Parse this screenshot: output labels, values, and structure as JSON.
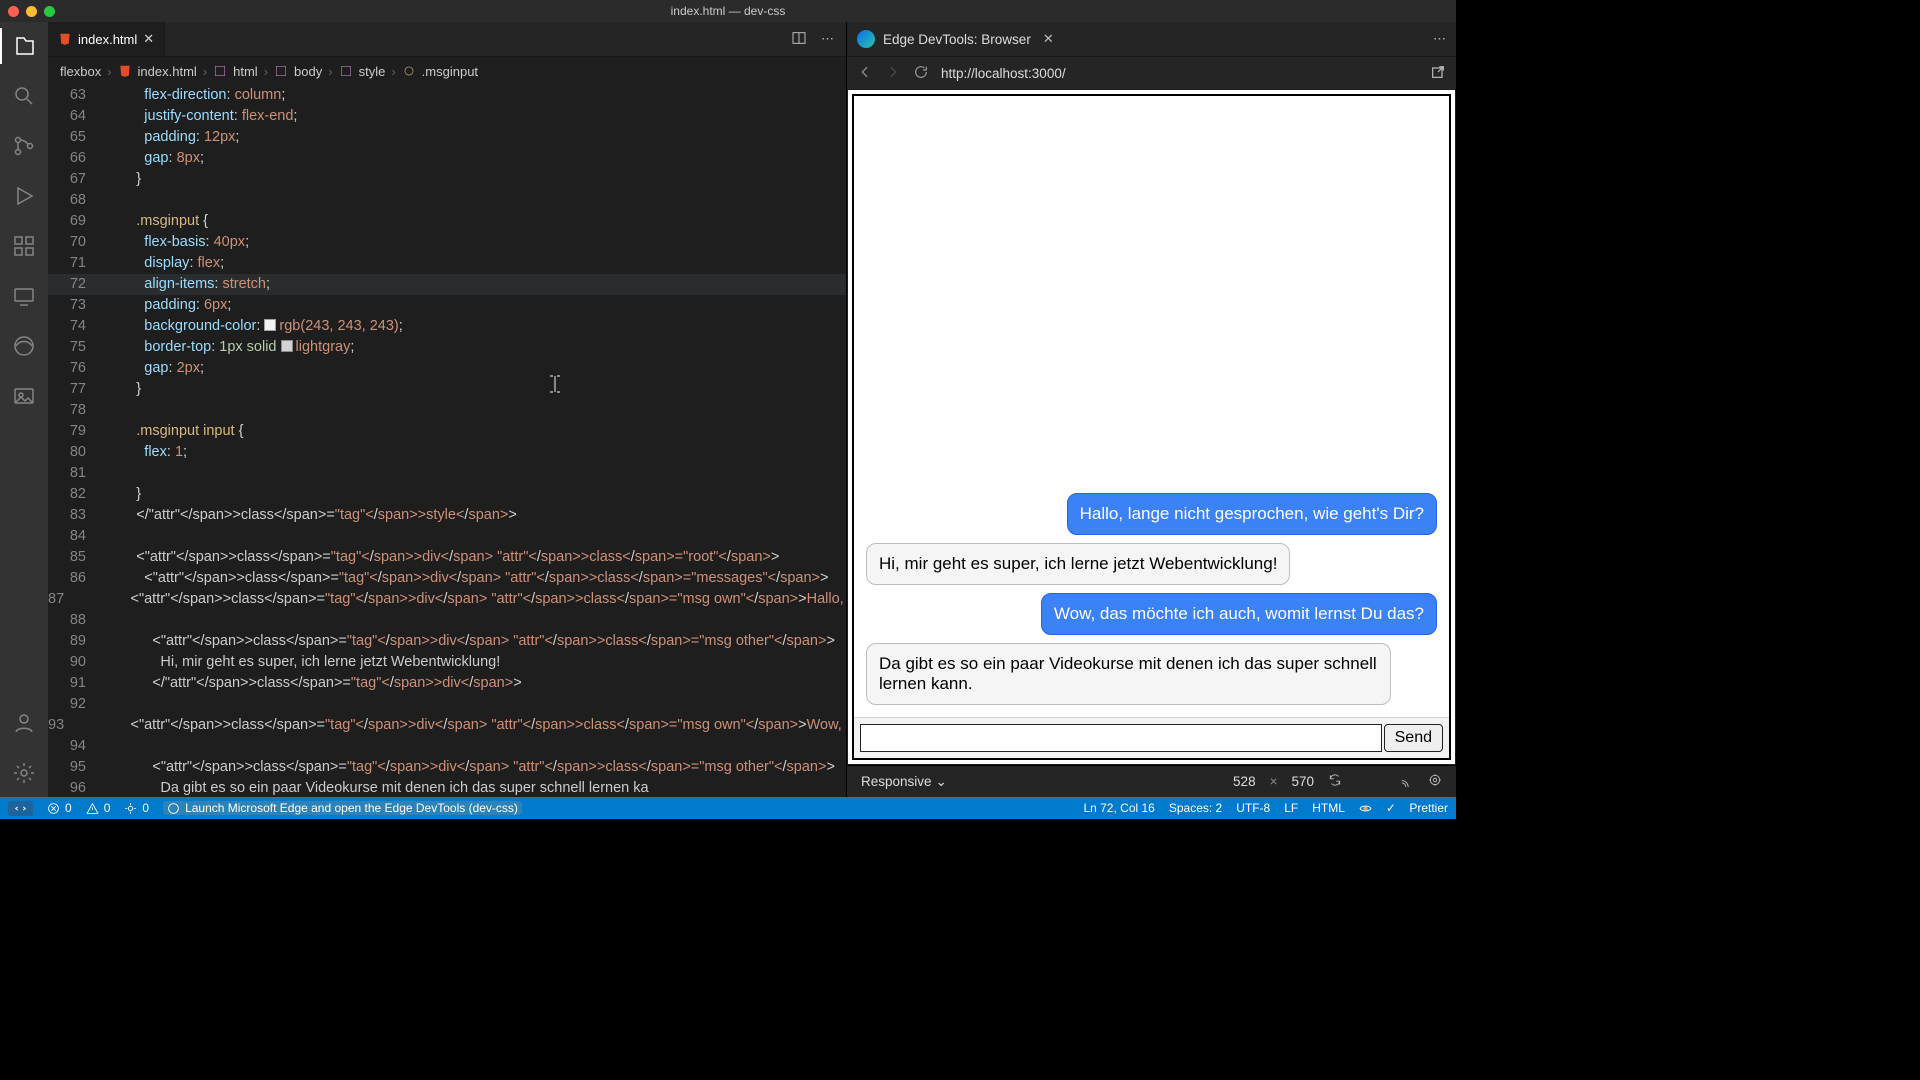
{
  "window_title": "index.html — dev-css",
  "activity_items": [
    "explorer",
    "search",
    "source-control",
    "run-debug",
    "extensions",
    "remote",
    "edge",
    "images"
  ],
  "activity_bottom": [
    "account",
    "settings"
  ],
  "tab": {
    "filename": "index.html"
  },
  "tab_actions": [
    "split-editor",
    "more"
  ],
  "breadcrumbs": [
    "flexbox",
    "index.html",
    "html",
    "body",
    "style",
    ".msginput"
  ],
  "code": [
    {
      "n": 63,
      "prop": "flex-direction",
      "val": "column"
    },
    {
      "n": 64,
      "prop": "justify-content",
      "val": "flex-end"
    },
    {
      "n": 65,
      "prop": "padding",
      "val": "12px"
    },
    {
      "n": 66,
      "prop": "gap",
      "val": "8px"
    },
    {
      "n": 67,
      "close": "}"
    },
    {
      "n": 68,
      "blank": true
    },
    {
      "n": 69,
      "sel": ".msginput",
      "open": "{"
    },
    {
      "n": 70,
      "prop": "flex-basis",
      "val": "40px"
    },
    {
      "n": 71,
      "prop": "display",
      "val": "flex"
    },
    {
      "n": 72,
      "prop": "align-items",
      "val": "stretch",
      "hl": true
    },
    {
      "n": 73,
      "prop": "padding",
      "val": "6px"
    },
    {
      "n": 74,
      "prop": "background-color",
      "sw": "#f3f3f3",
      "val": "rgb(243, 243, 243)"
    },
    {
      "n": 75,
      "prop": "border-top",
      "preval": "1px solid ",
      "sw": "#d3d3d3",
      "val": "lightgray"
    },
    {
      "n": 76,
      "prop": "gap",
      "val": "2px"
    },
    {
      "n": 77,
      "close": "}"
    },
    {
      "n": 78,
      "blank": true
    },
    {
      "n": 79,
      "sel": ".msginput input",
      "open": "{"
    },
    {
      "n": 80,
      "prop": "flex",
      "val": "1"
    },
    {
      "n": 81,
      "blank": true
    },
    {
      "n": 82,
      "close": "}"
    },
    {
      "n": 83,
      "html": "</style>"
    },
    {
      "n": 84,
      "blank": true
    },
    {
      "n": 85,
      "html": "<div class=\"root\">"
    },
    {
      "n": 86,
      "html": "  <div class=\"messages\">"
    },
    {
      "n": 87,
      "html": "    <div class=\"msg own\">Hallo, lange nicht gesprochen, wie geht's Dir?</div>"
    },
    {
      "n": 88,
      "blank": true
    },
    {
      "n": 89,
      "html": "    <div class=\"msg other\">"
    },
    {
      "n": 90,
      "html": "      Hi, mir geht es super, ich lerne jetzt Webentwicklung!"
    },
    {
      "n": 91,
      "html": "    </div>"
    },
    {
      "n": 92,
      "blank": true
    },
    {
      "n": 93,
      "html": "    <div class=\"msg own\">Wow, das möchte ich auch, womit lernst Du das?</div>"
    },
    {
      "n": 94,
      "blank": true
    },
    {
      "n": 95,
      "html": "    <div class=\"msg other\">"
    },
    {
      "n": 96,
      "html": "      Da gibt es so ein paar Videokurse mit denen ich das super schnell lernen ka"
    }
  ],
  "devtools": {
    "title": "Edge DevTools: Browser",
    "url": "http://localhost:3000/",
    "responsive_label": "Responsive",
    "width": "528",
    "x": "×",
    "height": "570"
  },
  "chat": {
    "messages": [
      {
        "cls": "own",
        "t": "Hallo, lange nicht gesprochen, wie geht's Dir?"
      },
      {
        "cls": "other",
        "t": "Hi, mir geht es super, ich lerne jetzt Webentwicklung!"
      },
      {
        "cls": "own",
        "t": "Wow, das möchte ich auch, womit lernst Du das?"
      },
      {
        "cls": "other",
        "t": "Da gibt es so ein paar Videokurse mit denen ich das super schnell lernen kann."
      }
    ],
    "send": "Send"
  },
  "status": {
    "remote": "",
    "errors": "0",
    "warnings": "0",
    "ports": "0",
    "launch": "Launch Microsoft Edge and open the Edge DevTools (dev-css)",
    "cursor": "Ln 72, Col 16",
    "spaces": "Spaces: 2",
    "enc": "UTF-8",
    "eol": "LF",
    "lang": "HTML",
    "prettier": "Prettier"
  }
}
